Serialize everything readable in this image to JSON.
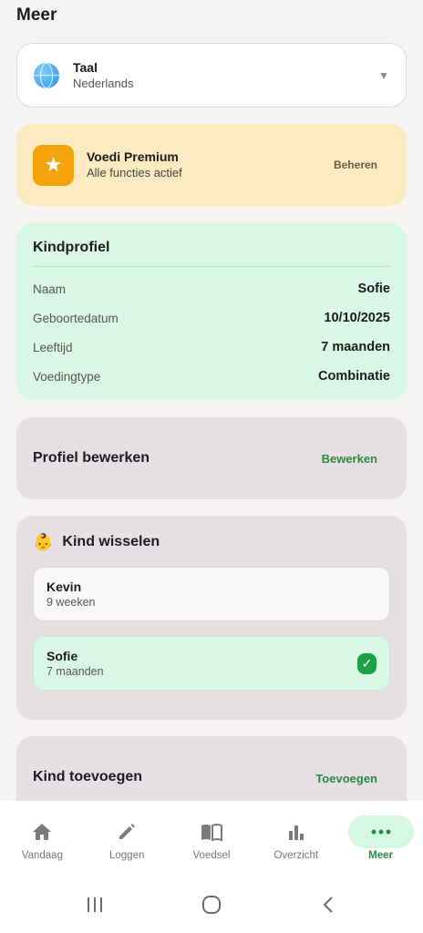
{
  "header": {
    "title": "Meer"
  },
  "language": {
    "title": "Taal",
    "value": "Nederlands",
    "icon": "globe-icon"
  },
  "premium": {
    "title": "Voedi Premium",
    "subtitle": "Alle functies actief",
    "action": "Beheren",
    "icon": "star-icon",
    "icon_color": "#f5a30a"
  },
  "profile": {
    "title": "Kindprofiel",
    "rows": [
      {
        "label": "Naam",
        "value": "Sofie"
      },
      {
        "label": "Geboortedatum",
        "value": "10/10/2025"
      },
      {
        "label": "Leeftijd",
        "value": "7 maanden"
      },
      {
        "label": "Voedingtype",
        "value": "Combinatie"
      }
    ]
  },
  "edit_profile": {
    "title": "Profiel bewerken",
    "action": "Bewerken"
  },
  "switch_child": {
    "title": "Kind wisselen",
    "icon": "baby-icon",
    "children": [
      {
        "name": "Kevin",
        "age": "9 weeken",
        "selected": false
      },
      {
        "name": "Sofie",
        "age": "7 maanden",
        "selected": true
      }
    ]
  },
  "add_child": {
    "title": "Kind toevoegen",
    "action": "Toevoegen"
  },
  "nav": {
    "items": [
      {
        "label": "Vandaag",
        "icon": "home-icon",
        "active": false
      },
      {
        "label": "Loggen",
        "icon": "pencil-icon",
        "active": false
      },
      {
        "label": "Voedsel",
        "icon": "book-icon",
        "active": false
      },
      {
        "label": "Overzicht",
        "icon": "bar-chart-icon",
        "active": false
      },
      {
        "label": "Meer",
        "icon": "more-icon",
        "active": true
      }
    ]
  },
  "colors": {
    "accent": "#2b8a3e",
    "premium_bg": "#fcebc0",
    "profile_bg": "#d9f8e5",
    "card_bg": "#e6e0e5"
  }
}
